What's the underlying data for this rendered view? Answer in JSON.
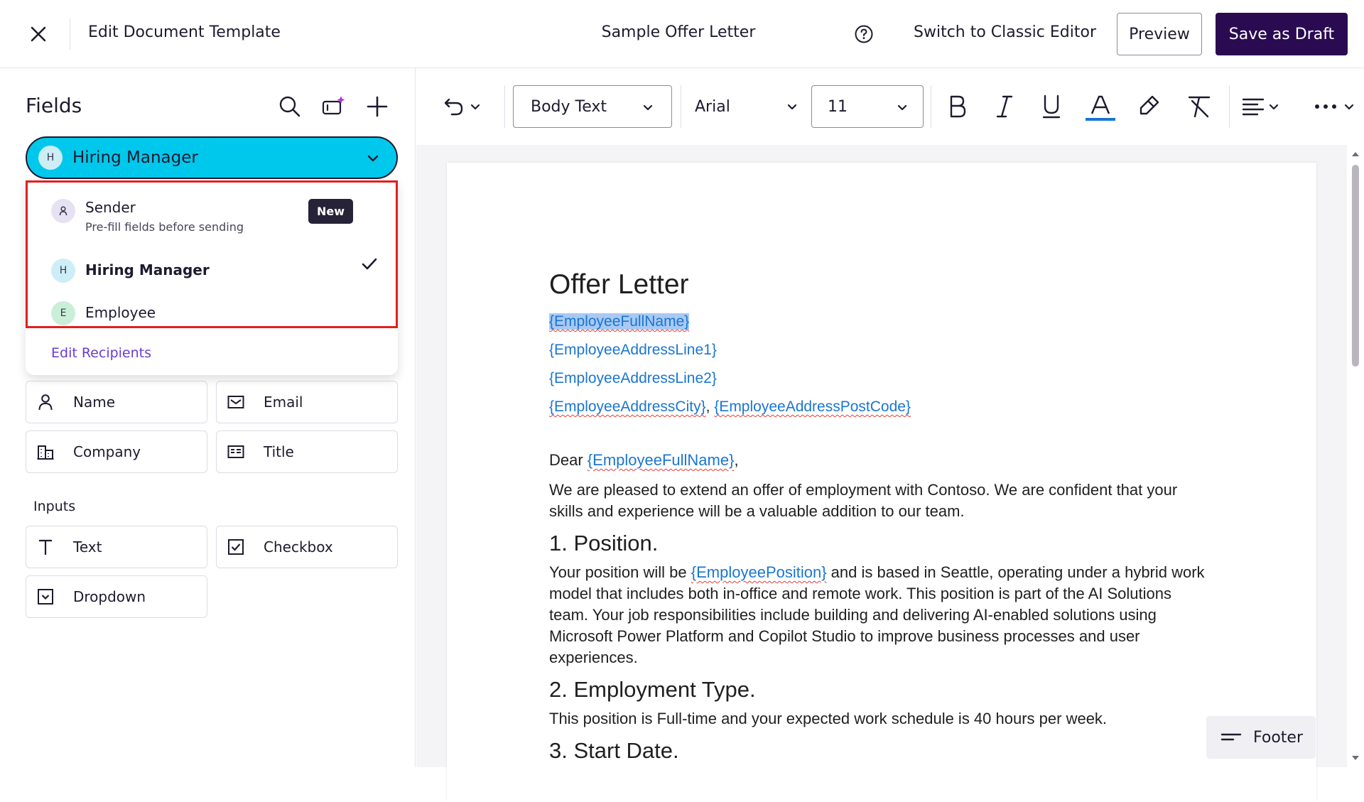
{
  "header": {
    "close_icon": "close-icon",
    "title": "Edit Document Template",
    "document_name": "Sample Offer Letter",
    "help_icon": "help-circle-icon",
    "classic_editor_link": "Switch to Classic Editor",
    "preview_button": "Preview",
    "save_draft_button": "Save as Draft"
  },
  "sidebar": {
    "title": "Fields",
    "recipient_select": {
      "avatar_letter": "H",
      "selected": "Hiring Manager"
    },
    "recipient_dropdown": {
      "options": [
        {
          "avatar": "",
          "name": "Sender",
          "subtitle": "Pre-fill fields before sending",
          "badge": "New"
        },
        {
          "avatar": "H",
          "name": "Hiring Manager",
          "selected": true
        },
        {
          "avatar": "E",
          "name": "Employee"
        }
      ],
      "edit_link": "Edit Recipients"
    },
    "field_buttons": [
      {
        "label": "Name",
        "icon": "person-icon"
      },
      {
        "label": "Email",
        "icon": "email-icon"
      },
      {
        "label": "Company",
        "icon": "building-icon"
      },
      {
        "label": "Title",
        "icon": "id-card-icon"
      }
    ],
    "inputs_label": "Inputs",
    "input_buttons": [
      {
        "label": "Text",
        "icon": "text-icon"
      },
      {
        "label": "Checkbox",
        "icon": "checkbox-icon"
      },
      {
        "label": "Dropdown",
        "icon": "dropdown-icon"
      }
    ]
  },
  "toolbar": {
    "paragraph_style": "Body Text",
    "font": "Arial",
    "font_size": "11",
    "accent_underline_color": "#1a76d2"
  },
  "document": {
    "heading": "Offer Letter",
    "placeholders": {
      "full_name": "{EmployeeFullName}",
      "address1": "{EmployeeAddressLine1}",
      "address2": "{EmployeeAddressLine2}",
      "city": "{EmployeeAddressCity}",
      "city_sep": ", ",
      "postcode": "{EmployeeAddressPostCode}",
      "position": "{EmployeePosition}"
    },
    "greeting_prefix": "Dear ",
    "greeting_suffix": ",",
    "intro": "We are pleased to extend an offer of employment with Contoso. We are confident that your skills and experience will be a valuable addition to our team.",
    "section1_title": "1. Position.",
    "section1_prefix": "Your position will be ",
    "section1_suffix": " and is based in Seattle, operating under a hybrid work model that includes both in-office and remote work. This position is part of the AI Solutions team. Your job responsibilities include building and delivering AI-enabled solutions using Microsoft Power Platform and Copilot Studio to improve business processes and user experiences.",
    "section2_title": "2. Employment Type.",
    "section2_text": "This position is Full-time and your expected work schedule is 40 hours per week.",
    "section3_title": "3. Start Date."
  },
  "footer_button": "Footer",
  "colors": {
    "brand_dark": "#2a0b52",
    "recipient_accent": "#00c8ec",
    "highlight_border": "#e0201e",
    "link": "#6a3ad8",
    "placeholder": "#1a76d2"
  }
}
